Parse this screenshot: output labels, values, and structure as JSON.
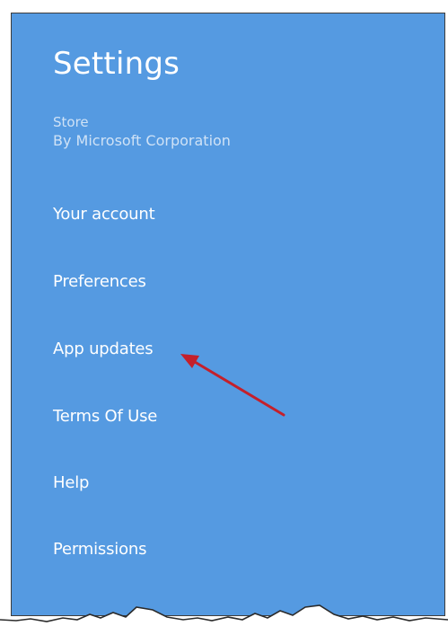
{
  "settings": {
    "title": "Settings",
    "app_name": "Store",
    "publisher": "By Microsoft Corporation",
    "items": [
      {
        "label": "Your account"
      },
      {
        "label": "Preferences"
      },
      {
        "label": "App updates"
      },
      {
        "label": "Terms Of Use"
      },
      {
        "label": "Help"
      },
      {
        "label": "Permissions"
      }
    ]
  },
  "colors": {
    "panel_background": "#559ae1",
    "text": "#ffffff",
    "subtext": "#cfe2f6",
    "annotation_arrow": "#c4202b"
  }
}
